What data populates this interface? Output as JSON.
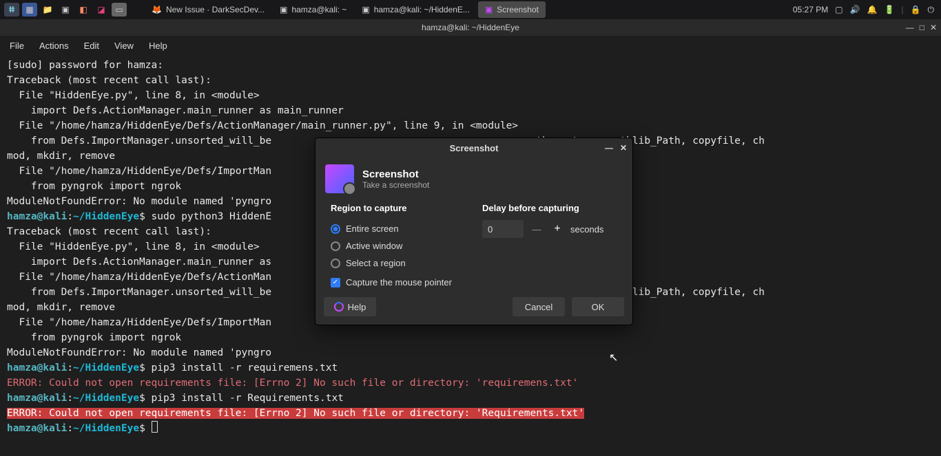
{
  "taskbar": {
    "tasks": [
      {
        "icon": "🦊",
        "label": "New Issue · DarkSecDev..."
      },
      {
        "icon": "▣",
        "label": "hamza@kali: ~"
      },
      {
        "icon": "▣",
        "label": "hamza@kali: ~/HiddenE..."
      },
      {
        "icon": "▣",
        "label": "Screenshot"
      }
    ],
    "clock": "05:27 PM"
  },
  "terminal": {
    "title": "hamza@kali: ~/HiddenEye",
    "menu": [
      "File",
      "Actions",
      "Edit",
      "View",
      "Help"
    ],
    "lines": [
      {
        "t": "[sudo] password for hamza:"
      },
      {
        "t": "Traceback (most recent call last):"
      },
      {
        "t": "  File \"HiddenEye.py\", line 8, in <module>"
      },
      {
        "t": "    import Defs.ActionManager.main_runner as main_runner"
      },
      {
        "t": "  File \"/home/hamza/HiddenEye/Defs/ActionManager/main_runner.py\", line 9, in <module>"
      },
      {
        "t": "    from Defs.ImportManager.unsorted_will_be                                        , path, rmtree, pathlib_Path, copyfile, ch"
      },
      {
        "t": "mod, mkdir, remove"
      },
      {
        "t": "  File \"/home/hamza/HiddenEye/Defs/ImportMan                                        <module>"
      },
      {
        "t": "    from pyngrok import ngrok"
      },
      {
        "t": "ModuleNotFoundError: No module named 'pyngro"
      },
      {
        "p": true,
        "c": "sudo python3 HiddenE"
      },
      {
        "t": "Traceback (most recent call last):"
      },
      {
        "t": "  File \"HiddenEye.py\", line 8, in <module>"
      },
      {
        "t": "    import Defs.ActionManager.main_runner as"
      },
      {
        "t": "  File \"/home/hamza/HiddenEye/Defs/ActionMan"
      },
      {
        "t": "    from Defs.ImportManager.unsorted_will_be                                        , path, rmtree, pathlib_Path, copyfile, ch"
      },
      {
        "t": "mod, mkdir, remove"
      },
      {
        "t": "  File \"/home/hamza/HiddenEye/Defs/ImportMan                                        <module>"
      },
      {
        "t": "    from pyngrok import ngrok"
      },
      {
        "t": "ModuleNotFoundError: No module named 'pyngro"
      },
      {
        "p": true,
        "c": "pip3 install -r requiremens.txt"
      },
      {
        "e": true,
        "t": "ERROR: Could not open requirements file: [Errno 2] No such file or directory: 'requiremens.txt'"
      },
      {
        "p": true,
        "c": "pip3 install -r Requirements.txt"
      },
      {
        "eh": true,
        "t": "ERROR: Could not open requirements file: [Errno 2] No such file or directory: 'Requirements.txt'"
      },
      {
        "p": true,
        "c": "",
        "cur": true
      }
    ],
    "prompt_user": "hamza@kali",
    "prompt_sep": ":",
    "prompt_path": "~/HiddenEye",
    "prompt_end": "$ "
  },
  "dialog": {
    "wintitle": "Screenshot",
    "title": "Screenshot",
    "subtitle": "Take a screenshot",
    "region_label": "Region to capture",
    "delay_label": "Delay before capturing",
    "options": [
      {
        "label": "Entire screen",
        "checked": true
      },
      {
        "label": "Active window",
        "checked": false
      },
      {
        "label": "Select a region",
        "checked": false
      }
    ],
    "capture_pointer": "Capture the mouse pointer",
    "delay_value": "0",
    "delay_unit": "seconds",
    "help": "Help",
    "cancel": "Cancel",
    "ok": "OK"
  }
}
